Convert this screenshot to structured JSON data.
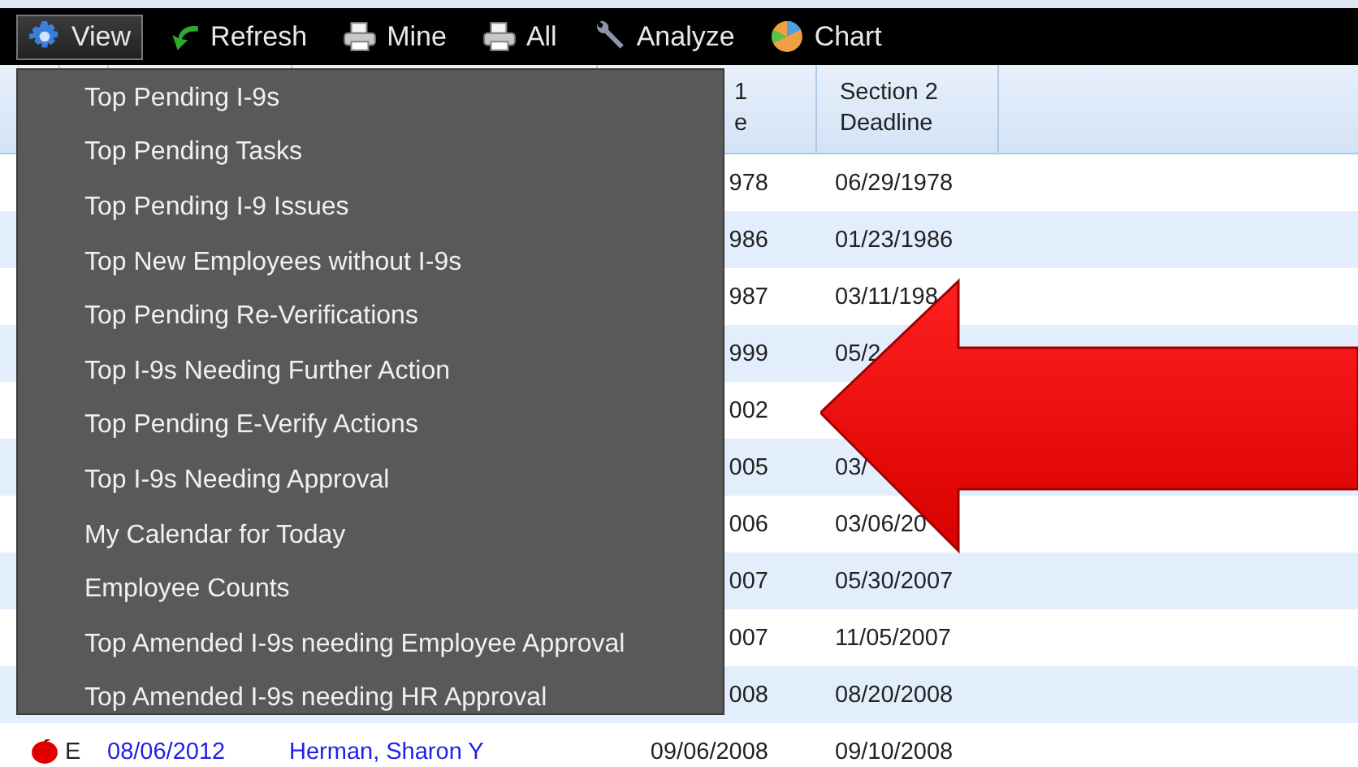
{
  "toolbar": {
    "buttons": [
      {
        "label": "View",
        "selected": true
      },
      {
        "label": "Refresh",
        "selected": false
      },
      {
        "label": "Mine",
        "selected": false
      },
      {
        "label": "All",
        "selected": false
      },
      {
        "label": "Analyze",
        "selected": false
      },
      {
        "label": "Chart",
        "selected": false
      }
    ]
  },
  "table": {
    "columns": [
      {
        "lines": [
          "1",
          "e"
        ]
      },
      {
        "lines": [
          "Section 2",
          "Deadline"
        ]
      }
    ],
    "rows": [
      {
        "section_1": "978",
        "section_2": "06/29/1978"
      },
      {
        "section_1": "986",
        "section_2": "01/23/1986"
      },
      {
        "section_1": "987",
        "section_2": "03/11/198"
      },
      {
        "section_1": "999",
        "section_2": "05/2"
      },
      {
        "section_1": "002"
      },
      {
        "section_1": "005",
        "section_2": "03/"
      },
      {
        "section_1": "006",
        "section_2": "03/06/20"
      },
      {
        "section_1": "007",
        "section_2": "05/30/2007"
      },
      {
        "section_1": "007",
        "section_2": "11/05/2007"
      },
      {
        "section_1": "008",
        "section_2": "08/20/2008"
      },
      {
        "flagged": true,
        "type": "E",
        "date": "08/06/2012",
        "name": "Herman, Sharon Y",
        "section_1": "09/06/2008",
        "section_2": "09/10/2008"
      }
    ]
  },
  "view_menu": {
    "items": [
      "Top Pending I-9s",
      "Top Pending Tasks",
      "Top Pending I-9 Issues",
      "Top New Employees without I-9s",
      "Top Pending Re-Verifications",
      "Top I-9s Needing Further Action",
      "Top Pending E-Verify Actions",
      "Top I-9s Needing Approval",
      "My Calendar for Today",
      "Employee Counts",
      "Top Amended I-9s needing Employee Approval",
      "Top Amended I-9s needing HR Approval"
    ]
  }
}
